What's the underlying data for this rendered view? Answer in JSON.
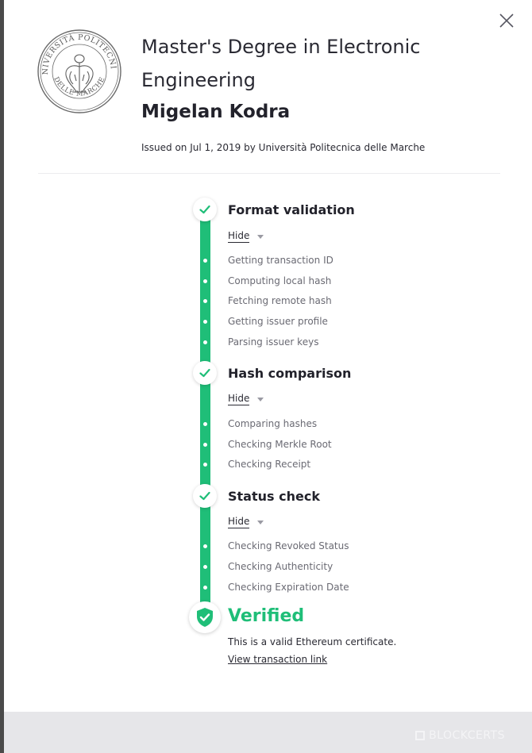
{
  "certificate": {
    "title": "Master's Degree in Electronic Engineering",
    "recipient": "Migelan Kodra",
    "issued": "Issued on Jul 1, 2019 by Università Politecnica delle Marche",
    "seal": {
      "top_text": "UNIVERSITÀ POLITECNICA",
      "bottom_text": "DELLE MARCHE"
    }
  },
  "steps": [
    {
      "title": "Format validation",
      "toggle_label": "Hide",
      "substeps": [
        "Getting transaction ID",
        "Computing local hash",
        "Fetching remote hash",
        "Getting issuer profile",
        "Parsing issuer keys"
      ]
    },
    {
      "title": "Hash comparison",
      "toggle_label": "Hide",
      "substeps": [
        "Comparing hashes",
        "Checking Merkle Root",
        "Checking Receipt"
      ]
    },
    {
      "title": "Status check",
      "toggle_label": "Hide",
      "substeps": [
        "Checking Revoked Status",
        "Checking Authenticity",
        "Checking Expiration Date"
      ]
    }
  ],
  "result": {
    "title": "Verified",
    "message": "This is a valid Ethereum certificate.",
    "link_label": "View transaction link"
  },
  "footer": {
    "brand": "BLOCKCERTS"
  },
  "colors": {
    "accent": "#1fbe78",
    "text": "#2a2a33",
    "muted": "#6a6a73",
    "footer_bg": "#e6e6e9"
  },
  "icons": {
    "close": "close-icon",
    "step_done": "check-icon",
    "verified": "shield-check-icon",
    "brand": "blockcerts-logo-icon"
  }
}
